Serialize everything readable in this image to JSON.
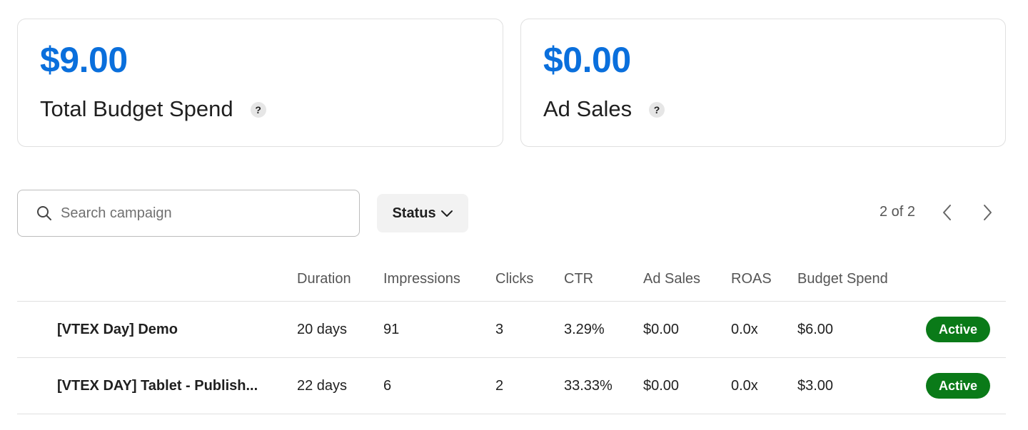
{
  "summary": {
    "spend": {
      "value": "$9.00",
      "label": "Total Budget Spend",
      "help": "?"
    },
    "sales": {
      "value": "$0.00",
      "label": "Ad Sales",
      "help": "?"
    }
  },
  "toolbar": {
    "search_placeholder": "Search campaign",
    "search_value": "",
    "status_label": "Status",
    "pagination": "2 of 2"
  },
  "table": {
    "headers": {
      "name": "",
      "duration": "Duration",
      "impressions": "Impressions",
      "clicks": "Clicks",
      "ctr": "CTR",
      "ad_sales": "Ad Sales",
      "roas": "ROAS",
      "budget_spend": "Budget Spend"
    },
    "rows": [
      {
        "name": "[VTEX Day] Demo",
        "duration": "20 days",
        "impressions": "91",
        "clicks": "3",
        "ctr": "3.29%",
        "ad_sales": "$0.00",
        "roas": "0.0x",
        "budget_spend": "$6.00",
        "status": "Active"
      },
      {
        "name": "[VTEX DAY] Tablet - Publish...",
        "duration": "22 days",
        "impressions": "6",
        "clicks": "2",
        "ctr": "33.33%",
        "ad_sales": "$0.00",
        "roas": "0.0x",
        "budget_spend": "$3.00",
        "status": "Active"
      }
    ]
  },
  "colors": {
    "accent": "#0a6fdc",
    "active_badge": "#0a7a18",
    "border": "#e0e0e0"
  },
  "icons": {
    "search": "search-icon",
    "status_chevron": "chevron-down-icon",
    "prev": "chevron-left-icon",
    "next": "chevron-right-icon",
    "help": "help-icon"
  }
}
